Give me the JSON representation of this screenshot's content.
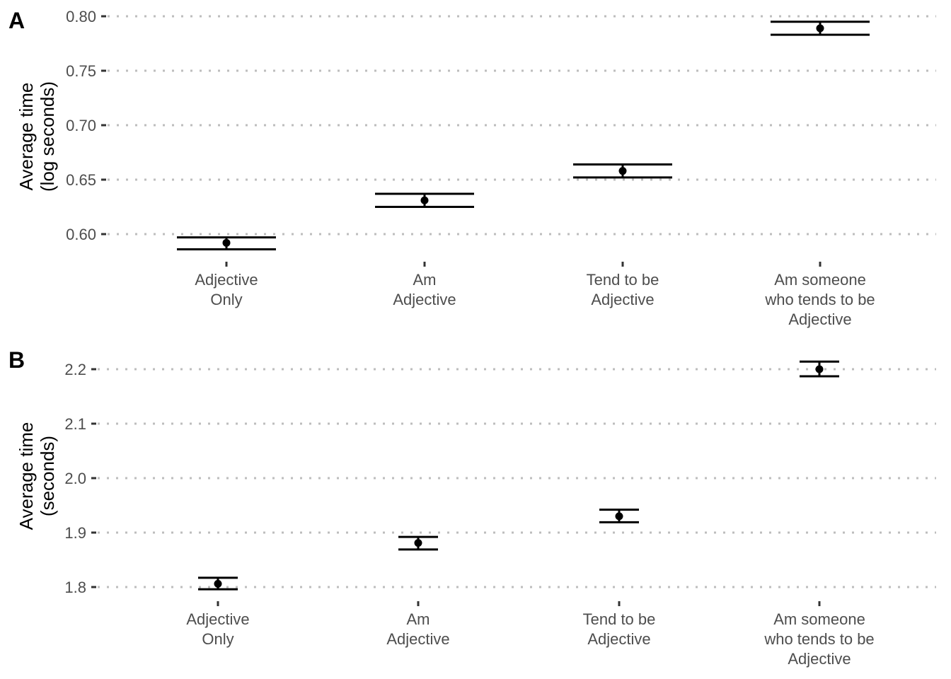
{
  "chart_data": [
    {
      "panel": "A",
      "type": "scatter",
      "subtype": "point-with-error-bars",
      "title": "",
      "xlabel": "",
      "ylabel": "Average time\n(log seconds)",
      "categories": [
        "Adjective\nOnly",
        "Am\nAdjective",
        "Tend to be\nAdjective",
        "Am someone\nwho tends to be\nAdjective"
      ],
      "values": [
        0.592,
        0.631,
        0.658,
        0.789
      ],
      "error_upper": [
        0.597,
        0.637,
        0.664,
        0.795
      ],
      "error_lower": [
        0.586,
        0.625,
        0.652,
        0.783
      ],
      "yticks": [
        0.6,
        0.65,
        0.7,
        0.75,
        0.8
      ],
      "ytick_labels": [
        "0.60",
        "0.65",
        "0.70",
        "0.75",
        "0.80"
      ],
      "ylim": [
        0.578,
        0.8
      ],
      "grid": "horizontal dotted",
      "legend": "none"
    },
    {
      "panel": "B",
      "type": "scatter",
      "subtype": "point-with-error-bars",
      "title": "",
      "xlabel": "",
      "ylabel": "Average time\n(seconds)",
      "categories": [
        "Adjective\nOnly",
        "Am\nAdjective",
        "Tend to be\nAdjective",
        "Am someone\nwho tends to be\nAdjective"
      ],
      "values": [
        1.806,
        1.881,
        1.93,
        2.2
      ],
      "error_upper": [
        1.817,
        1.892,
        1.942,
        2.214
      ],
      "error_lower": [
        1.796,
        1.869,
        1.919,
        2.187
      ],
      "yticks": [
        1.8,
        1.9,
        2.0,
        2.1,
        2.2
      ],
      "ytick_labels": [
        "1.8",
        "1.9",
        "2.0",
        "2.1",
        "2.2"
      ],
      "ylim": [
        1.775,
        2.2
      ],
      "grid": "horizontal dotted",
      "legend": "none"
    }
  ]
}
